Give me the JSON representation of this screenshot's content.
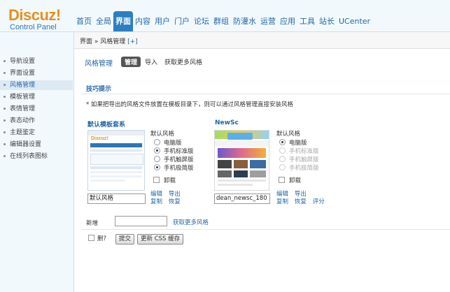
{
  "logo": {
    "brand": "Discuz!",
    "subtitle": "Control Panel"
  },
  "topnav": [
    "首页",
    "全局",
    "界面",
    "内容",
    "用户",
    "门户",
    "论坛",
    "群组",
    "防灌水",
    "运营",
    "应用",
    "工具",
    "站长",
    "UCenter"
  ],
  "breadcrumb": {
    "text": "界面 » 风格管理",
    "add": "[+]"
  },
  "sidebar": [
    "导航设置",
    "界面设置",
    "风格管理",
    "模板管理",
    "表情管理",
    "表态动作",
    "主题鉴定",
    "编辑器设置",
    "在线列表图标"
  ],
  "main": {
    "title": "风格管理",
    "tabs": {
      "manage": "管理",
      "import": "导入",
      "more": "获取更多风格"
    },
    "tips_title": "技巧提示",
    "tips_text": "* 如果把导出的风格文件放置在模板目录下，则可以通过风格管理直接安装风格"
  },
  "styles": [
    {
      "name": "默认模板套系",
      "default_label": "默认风格",
      "options": [
        "电脑版",
        "手机标准版",
        "手机触屏版",
        "手机极简版"
      ],
      "uninstall": "卸载",
      "input_value": "默认风格",
      "links_row1": [
        "编辑",
        "导出"
      ],
      "links_row2": [
        "复制",
        "恢复"
      ]
    },
    {
      "name": "NewSc",
      "default_label": "默认风格",
      "options": [
        "电脑版",
        "手机标准版",
        "手机触屏版",
        "手机极简版"
      ],
      "uninstall": "卸载",
      "input_value": "dean_newsc_180",
      "links_row1": [
        "编辑",
        "导出"
      ],
      "links_row2": [
        "复制",
        "恢复",
        "评分"
      ]
    }
  ],
  "new_row": {
    "label": "新增",
    "link": "获取更多风格"
  },
  "footer": {
    "delete_label": "删?",
    "submit": "提交",
    "update_css": "更新 CSS 缓存"
  }
}
